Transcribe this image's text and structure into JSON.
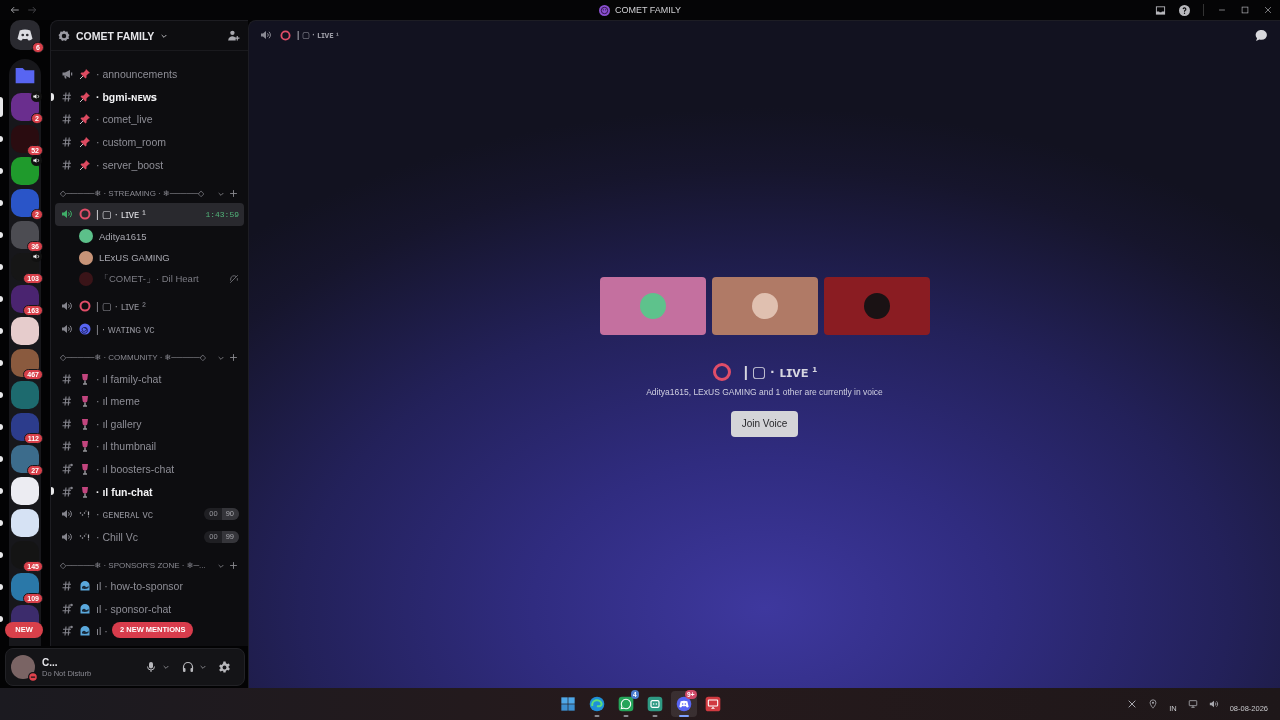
{
  "title_bar": {
    "title": "COMET FAMILY"
  },
  "servers": {
    "home_badge": "6",
    "new_pill": "NEW",
    "items": [
      {
        "kind": "folder",
        "selected": false,
        "unread": false
      },
      {
        "kind": "server",
        "color": "#6a2e8e",
        "badge": "2",
        "voice": true,
        "selected": true,
        "unread": false
      },
      {
        "kind": "server",
        "color": "#2a0c10",
        "badge": "52",
        "voice": false,
        "selected": false,
        "unread": true
      },
      {
        "kind": "server",
        "color": "#1f9a2c",
        "voice": true,
        "selected": false,
        "unread": true
      },
      {
        "kind": "server",
        "color": "#2a55c8",
        "badge": "2",
        "voice": false,
        "selected": false,
        "unread": true
      },
      {
        "kind": "server",
        "color": "#4c4c52",
        "badge": "36",
        "voice": false,
        "selected": false,
        "unread": true
      },
      {
        "kind": "server",
        "color": "#161616",
        "badge": "103",
        "voice": true,
        "selected": false,
        "unread": true
      },
      {
        "kind": "server",
        "color": "#4a2470",
        "badge": "163",
        "voice": false,
        "selected": false,
        "unread": true
      },
      {
        "kind": "server",
        "color": "#e6cccc",
        "voice": false,
        "selected": false,
        "unread": true
      },
      {
        "kind": "server",
        "color": "#8a5a3e",
        "badge": "467",
        "voice": false,
        "selected": false,
        "unread": true
      },
      {
        "kind": "server",
        "color": "#1d6a6e",
        "voice": false,
        "selected": false,
        "unread": true
      },
      {
        "kind": "server",
        "color": "#2c3c8c",
        "badge": "112",
        "voice": false,
        "selected": false,
        "unread": true
      },
      {
        "kind": "server",
        "color": "#3c6c8c",
        "badge": "27",
        "voice": false,
        "selected": false,
        "unread": true
      },
      {
        "kind": "server",
        "color": "#ececf2",
        "voice": false,
        "selected": false,
        "unread": true
      },
      {
        "kind": "server",
        "color": "#d6e2f4",
        "voice": false,
        "selected": false,
        "unread": true
      },
      {
        "kind": "server",
        "color": "#141414",
        "badge": "145",
        "voice": false,
        "selected": false,
        "unread": true
      },
      {
        "kind": "server",
        "color": "#2a78a8",
        "badge": "109",
        "voice": false,
        "selected": false,
        "unread": true
      },
      {
        "kind": "server",
        "color": "#3c2c6c",
        "voice": false,
        "selected": false,
        "unread": true
      }
    ]
  },
  "sidebar": {
    "server_name": "COMET FAMILY",
    "new_mentions": "2 NEW MENTIONS",
    "categories": [
      {
        "channels": [
          {
            "kind": "announcement",
            "emoji": {
              "kind": "pin"
            },
            "name": "· announcements",
            "selected": false,
            "unread": false
          },
          {
            "kind": "text",
            "emoji": {
              "kind": "pin"
            },
            "name": "· bgmi-ɴᴇᴡꜱ",
            "selected": false,
            "unread": true
          },
          {
            "kind": "text",
            "emoji": {
              "kind": "pin"
            },
            "name": "· comet_live",
            "selected": false,
            "unread": false
          },
          {
            "kind": "text",
            "emoji": {
              "kind": "pin"
            },
            "name": "· custom_room",
            "selected": false,
            "unread": false
          },
          {
            "kind": "text",
            "emoji": {
              "kind": "pin"
            },
            "name": "· server_boost",
            "selected": false,
            "unread": false
          }
        ]
      },
      {
        "label": "◇─────❄ · STREAMING · ❄─────◇",
        "expanded": true,
        "channels": [
          {
            "kind": "voice",
            "emoji": {
              "kind": "ring"
            },
            "name": "| ▢ · ʟɪᴠᴇ ¹",
            "selected": true,
            "unread": false,
            "timer": "1:43:59",
            "members": [
              {
                "name": "Aditya1615",
                "color": "#5cc08a",
                "deafened": false
              },
              {
                "name": "LExUS GAMING",
                "color": "#c89478",
                "deafened": false
              },
              {
                "name": "「COMET-」· Dil Heart",
                "color": "#3a1418",
                "deafened": true
              }
            ]
          },
          {
            "kind": "voice",
            "emoji": {
              "kind": "ring"
            },
            "name": "| ▢ · ʟɪᴠᴇ ²",
            "selected": false,
            "unread": false
          },
          {
            "kind": "voice",
            "emoji": {
              "kind": "spiral"
            },
            "name": "| · ᴡᴀᴛɪɴɢ ᴠᴄ",
            "selected": false,
            "unread": false
          }
        ]
      },
      {
        "label": "◇─────❄ · COMMUNITY · ❄─────◇",
        "expanded": true,
        "channels": [
          {
            "kind": "text",
            "emoji": {
              "kind": "wine"
            },
            "name": "· ıl family-chat",
            "selected": false,
            "unread": false
          },
          {
            "kind": "text",
            "emoji": {
              "kind": "wine"
            },
            "name": "· ıl meme",
            "selected": false,
            "unread": false
          },
          {
            "kind": "text",
            "emoji": {
              "kind": "wine"
            },
            "name": "· ıl gallery",
            "selected": false,
            "unread": false
          },
          {
            "kind": "text",
            "emoji": {
              "kind": "wine"
            },
            "name": "· ıl thumbnail",
            "selected": false,
            "unread": false
          },
          {
            "kind": "threaded",
            "emoji": {
              "kind": "wine"
            },
            "name": "· ıl boosters-chat",
            "selected": false,
            "unread": false
          },
          {
            "kind": "threaded",
            "emoji": {
              "kind": "wine"
            },
            "name": "· ıl fun-chat",
            "selected": false,
            "unread": true
          },
          {
            "kind": "voice",
            "emoji": {
              "kind": "dots"
            },
            "name": "· ɢᴇɴᴇʀᴀʟ ᴠᴄ",
            "selected": false,
            "unread": false,
            "user_count": "00",
            "user_limit": "90"
          },
          {
            "kind": "voice",
            "emoji": {
              "kind": "dots"
            },
            "name": "· Chill Vc",
            "selected": false,
            "unread": false,
            "user_count": "00",
            "user_limit": "99"
          }
        ]
      },
      {
        "label": "◇─────❄ · SPONSOR'S ZONE · ❄─...",
        "expanded": true,
        "channels": [
          {
            "kind": "text",
            "emoji": {
              "kind": "whale"
            },
            "name": "ıl · how-to-sponsor",
            "selected": false,
            "unread": false
          },
          {
            "kind": "threaded",
            "emoji": {
              "kind": "whale"
            },
            "name": "ıl · sponsor-chat",
            "selected": false,
            "unread": false
          },
          {
            "kind": "threaded",
            "emoji": {
              "kind": "whale"
            },
            "name": "ıl ·",
            "selected": false,
            "unread": false
          }
        ]
      }
    ]
  },
  "user_panel": {
    "name": "C...",
    "status": "Do Not Disturb"
  },
  "main": {
    "channel_name": "| ▢ · ʟɪᴠᴇ ¹",
    "tiles": [
      {
        "color": "#c4709f",
        "avatar": {
          "color": "#5ec28c"
        }
      },
      {
        "color": "#b07a66",
        "avatar": {
          "color": "#e0c0b0"
        }
      },
      {
        "color": "#8a1c22",
        "avatar": {
          "color": "#1a1214"
        }
      }
    ],
    "title": "| ▢ · ʟɪᴠᴇ ¹",
    "subtitle": "Aditya1615, LExUS GAMING and 1 other are currently in voice",
    "join_button": "Join Voice"
  },
  "taskbar": {
    "apps": [
      {
        "kind": "start",
        "running": false,
        "active": false
      },
      {
        "kind": "browser",
        "running": true,
        "active": false
      },
      {
        "kind": "messenger",
        "badge": "4",
        "running": true,
        "active": false
      },
      {
        "kind": "window",
        "running": true,
        "active": false
      },
      {
        "kind": "controller",
        "badge": "9+",
        "running": true,
        "active": true
      },
      {
        "kind": "cast",
        "running": false,
        "active": false
      }
    ],
    "tray": {
      "language": "IN",
      "date": "08-08-2026"
    }
  }
}
